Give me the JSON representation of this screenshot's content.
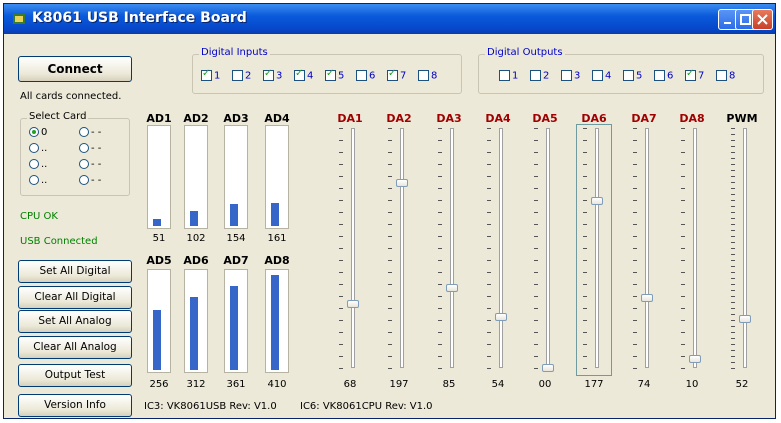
{
  "window": {
    "title": "K8061 USB Interface Board"
  },
  "left": {
    "connect_label": "Connect",
    "status_all": "All cards connected.",
    "select_card": {
      "legend": "Select Card",
      "options": [
        "0",
        "..",
        "..",
        "..",
        "- -",
        "- -",
        "- -",
        "- -"
      ],
      "selected": "0"
    },
    "cpu_status": "CPU OK",
    "usb_status": "USB Connected",
    "buttons": [
      "Set All Digital",
      "Clear All Digital",
      "Set All Analog",
      "Clear All Analog",
      "Output Test",
      "Version Info"
    ]
  },
  "digital_inputs": {
    "legend": "Digital Inputs",
    "items": [
      {
        "label": "1",
        "checked": true
      },
      {
        "label": "2",
        "checked": false
      },
      {
        "label": "3",
        "checked": true
      },
      {
        "label": "4",
        "checked": true
      },
      {
        "label": "5",
        "checked": true
      },
      {
        "label": "6",
        "checked": false
      },
      {
        "label": "7",
        "checked": true
      },
      {
        "label": "8",
        "checked": false
      }
    ]
  },
  "digital_outputs": {
    "legend": "Digital Outputs",
    "items": [
      {
        "label": "1",
        "checked": false
      },
      {
        "label": "2",
        "checked": false
      },
      {
        "label": "3",
        "checked": false
      },
      {
        "label": "4",
        "checked": false
      },
      {
        "label": "5",
        "checked": false
      },
      {
        "label": "6",
        "checked": false
      },
      {
        "label": "7",
        "checked": true
      },
      {
        "label": "8",
        "checked": false
      }
    ]
  },
  "analog_inputs": [
    {
      "name": "AD1",
      "value": "51",
      "level": 51
    },
    {
      "name": "AD2",
      "value": "102",
      "level": 102
    },
    {
      "name": "AD3",
      "value": "154",
      "level": 154
    },
    {
      "name": "AD4",
      "value": "161",
      "level": 161
    },
    {
      "name": "AD5",
      "value": "256",
      "level": 256
    },
    {
      "name": "AD6",
      "value": "312",
      "level": 312
    },
    {
      "name": "AD7",
      "value": "361",
      "level": 361
    },
    {
      "name": "AD8",
      "value": "410",
      "level": 410
    }
  ],
  "analog_outputs": [
    {
      "name": "DA1",
      "value": "68",
      "level": 68
    },
    {
      "name": "DA2",
      "value": "197",
      "level": 197
    },
    {
      "name": "DA3",
      "value": "85",
      "level": 85
    },
    {
      "name": "DA4",
      "value": "54",
      "level": 54
    },
    {
      "name": "DA5",
      "value": "00",
      "level": 0
    },
    {
      "name": "DA6",
      "value": "177",
      "level": 177
    },
    {
      "name": "DA7",
      "value": "74",
      "level": 74
    },
    {
      "name": "DA8",
      "value": "10",
      "level": 10
    },
    {
      "name": "PWM",
      "value": "52",
      "level": 52
    }
  ],
  "versions": {
    "ic3": "IC3: VK8061USB Rev: V1.0",
    "ic6": "IC6: VK8061CPU Rev: V1.0"
  }
}
